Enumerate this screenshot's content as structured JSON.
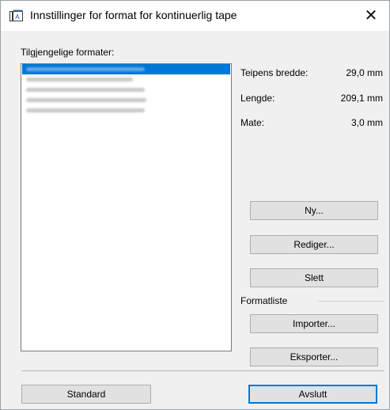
{
  "window": {
    "title": "Innstillinger for format for kontinuerlig tape",
    "close_symbol": "✕"
  },
  "formats": {
    "label": "Tilgjengelige formater:",
    "items": [
      {
        "text": "",
        "selected": true
      },
      {
        "text": "",
        "selected": false
      },
      {
        "text": "",
        "selected": false
      },
      {
        "text": "",
        "selected": false
      },
      {
        "text": "",
        "selected": false
      }
    ]
  },
  "properties": {
    "width_label": "Teipens bredde:",
    "width_value": "29,0 mm",
    "length_label": "Lengde:",
    "length_value": "209,1 mm",
    "feed_label": "Mate:",
    "feed_value": "3,0 mm"
  },
  "buttons": {
    "new": "Ny...",
    "edit": "Rediger...",
    "delete": "Slett",
    "import": "Importer...",
    "export": "Eksporter...",
    "standard": "Standard",
    "close": "Avslutt"
  },
  "format_list_group": "Formatliste",
  "colors": {
    "selection": "#0078d7",
    "default_button_border": "#0078d7"
  },
  "icons": {
    "app": "tape-format-icon",
    "close": "close-icon"
  }
}
